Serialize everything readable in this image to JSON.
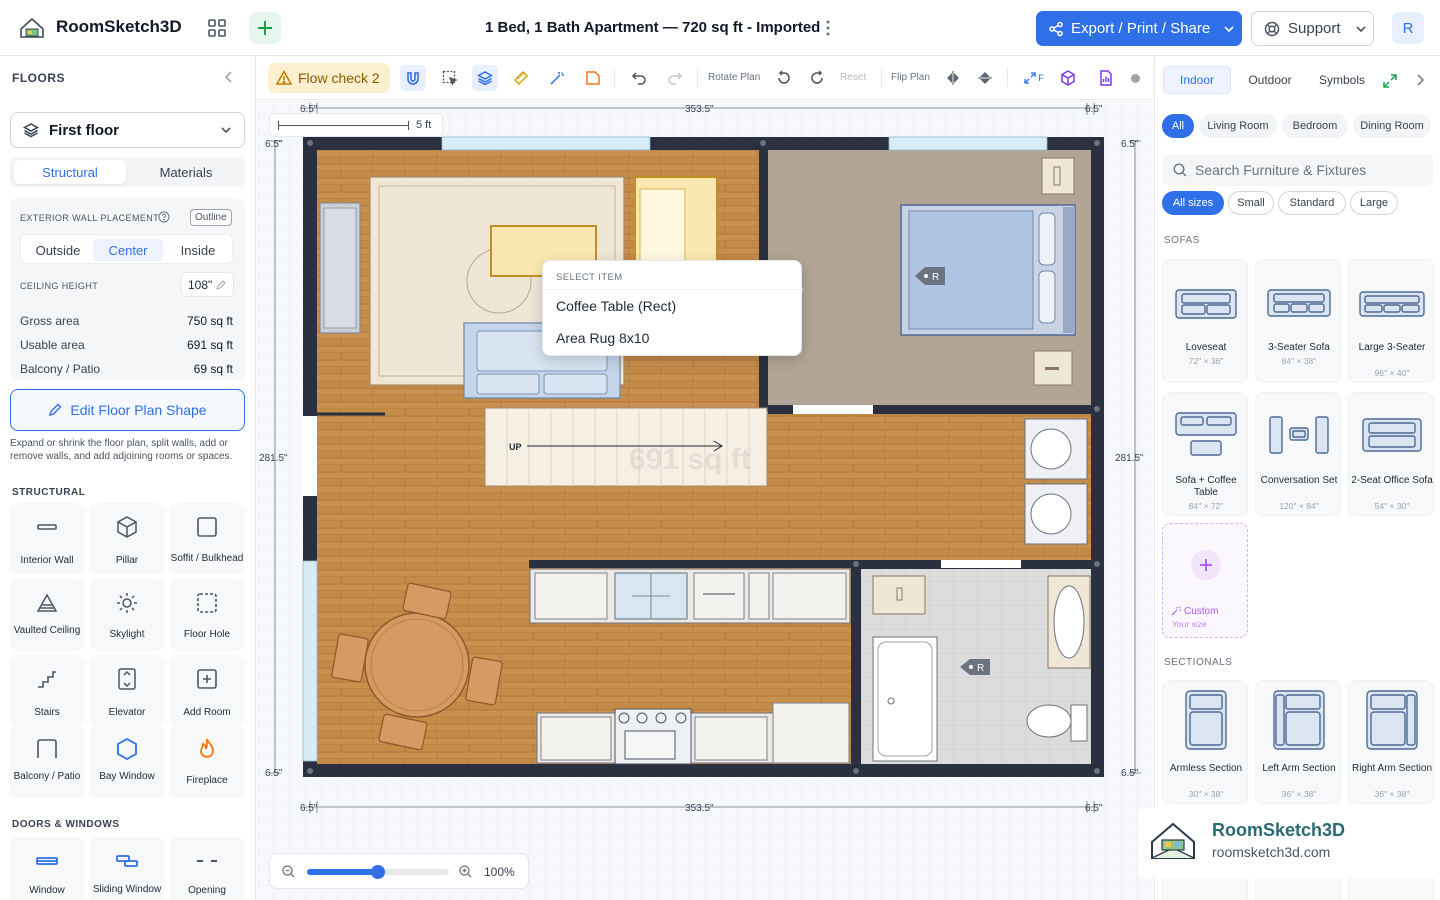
{
  "header": {
    "app_name": "RoomSketch3D",
    "plan_title": "1 Bed, 1 Bath Apartment — 720 sq ft - Imported",
    "export_label": "Export / Print / Share",
    "support_label": "Support",
    "avatar_initial": "R"
  },
  "left": {
    "floors_title": "FLOORS",
    "floor_name": "First floor",
    "tabs": [
      "Structural",
      "Materials"
    ],
    "wall_placement_label": "EXTERIOR WALL PLACEMENT",
    "outline_tag": "Outline",
    "placement_options": [
      "Outside",
      "Center",
      "Inside"
    ],
    "ceiling_label": "CEILING HEIGHT",
    "ceiling_value": "108\"",
    "areas": [
      {
        "label": "Gross area",
        "value": "750 sq ft"
      },
      {
        "label": "Usable area",
        "value": "691 sq ft"
      },
      {
        "label": "Balcony / Patio",
        "value": "69 sq ft"
      }
    ],
    "edit_shape_label": "Edit Floor Plan Shape",
    "edit_hint": "Expand or shrink the floor plan, split walls, add or remove walls, and add adjoining rooms or spaces.",
    "structural_title": "STRUCTURAL",
    "structural_tools": [
      "Interior Wall",
      "Pillar",
      "Soffit / Bulkhead",
      "Vaulted Ceiling",
      "Skylight",
      "Floor Hole",
      "Stairs",
      "Elevator",
      "Add Room",
      "Balcony / Patio",
      "Bay Window",
      "Fireplace"
    ],
    "doors_title": "DOORS & WINDOWS",
    "door_tools": [
      "Window",
      "Sliding Window",
      "Opening"
    ]
  },
  "toolbar": {
    "flow_check": "Flow check 2",
    "rotate_label": "Rotate Plan",
    "reset_label": "Reset",
    "flip_label": "Flip Plan",
    "fit_label": "F"
  },
  "canvas": {
    "dim_top_left": "6.5\"",
    "dim_top_mid": "353.5\"",
    "dim_top_right": "6.5\"",
    "dim_side_left": "281.5\"",
    "dim_side_right": "281.5\"",
    "dim_corner": "6.5\"",
    "scale_label": "5 ft",
    "stairs_label": "UP",
    "area_watermark": "691 sq ft",
    "door_marker": "R",
    "zoom_value": "100%",
    "zoom_fraction": 0.5,
    "popup": {
      "header": "SELECT ITEM",
      "items": [
        "Coffee Table (Rect)",
        "Area Rug 8x10"
      ]
    }
  },
  "right": {
    "tabs": [
      "Indoor",
      "Outdoor",
      "Symbols"
    ],
    "room_chips": [
      "All",
      "Living Room",
      "Bedroom",
      "Dining Room"
    ],
    "search_placeholder": "Search Furniture & Fixtures",
    "size_chips": [
      "All sizes",
      "Small",
      "Standard",
      "Large"
    ],
    "sofas_title": "SOFAS",
    "sofas": [
      {
        "name": "Loveseat",
        "dims": "72\" × 36\""
      },
      {
        "name": "3-Seater Sofa",
        "dims": "84\" × 38\""
      },
      {
        "name": "Large 3-Seater",
        "dims": "96\" × 40\""
      },
      {
        "name": "Sofa + Coffee Table",
        "dims": "84\" × 72\""
      },
      {
        "name": "Conversation Set",
        "dims": "120\" × 84\""
      },
      {
        "name": "2-Seat Office Sofa",
        "dims": "54\" × 30\""
      }
    ],
    "custom_label": "Custom",
    "custom_sub": "Your size",
    "sectionals_title": "SECTIONALS",
    "sectionals": [
      {
        "name": "Armless Section",
        "dims": "30\" × 38\""
      },
      {
        "name": "Left Arm Section",
        "dims": "36\" × 38\""
      },
      {
        "name": "Right Arm Section",
        "dims": "36\" × 38\""
      }
    ]
  },
  "watermark": {
    "brand": "RoomSketch3D",
    "url": "roomsketch3d.com"
  },
  "colors": {
    "accent": "#2f6fe8",
    "wall": "#2a3040",
    "wood_floor": "#c9904f",
    "bedroom_floor": "#b2a595",
    "tile_floor": "#dcdcdc"
  }
}
